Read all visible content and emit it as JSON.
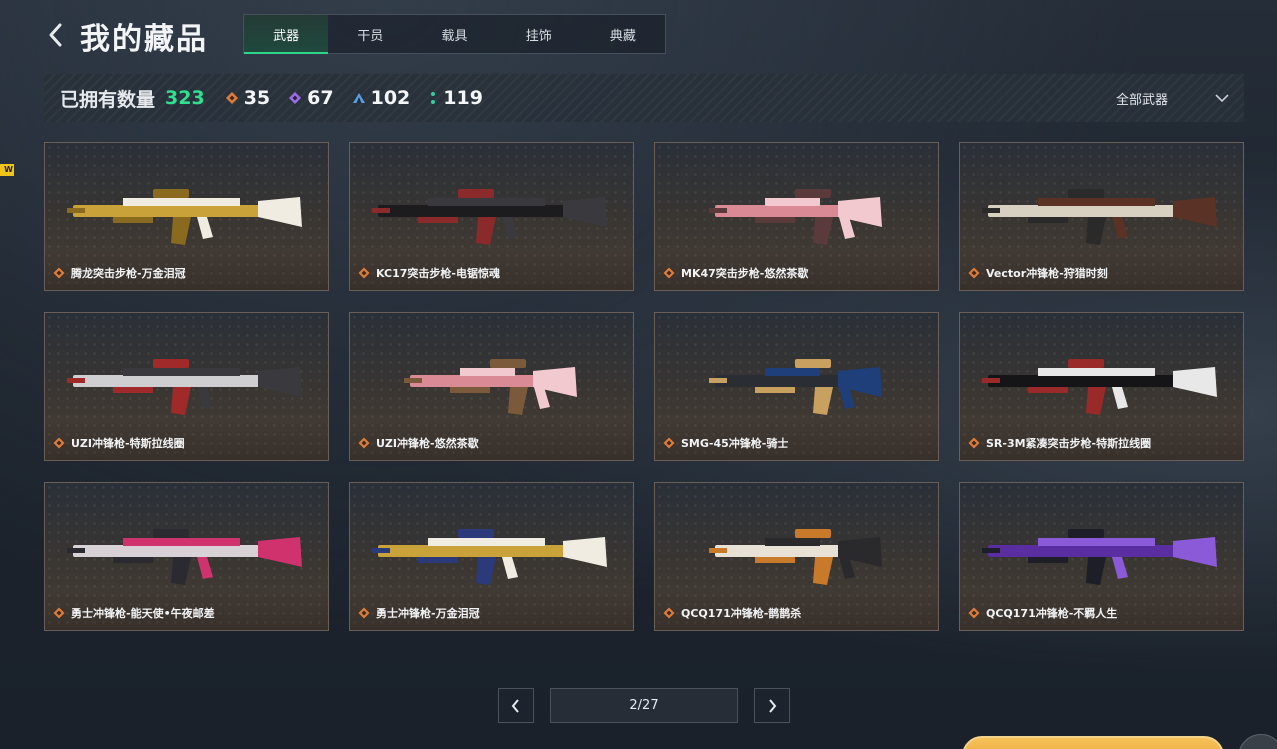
{
  "header": {
    "title": "我的藏品",
    "tabs": [
      {
        "label": "武器",
        "active": true
      },
      {
        "label": "干员",
        "active": false
      },
      {
        "label": "载具",
        "active": false
      },
      {
        "label": "挂饰",
        "active": false
      },
      {
        "label": "典藏",
        "active": false
      }
    ]
  },
  "badge": {
    "text": "W"
  },
  "stats": {
    "owned_label": "已拥有数量",
    "owned_count": "323",
    "rarities": [
      {
        "icon": "orange-diamond-icon",
        "color": "#e07c3a",
        "count": "35"
      },
      {
        "icon": "purple-diamond-icon",
        "color": "#9b6ee8",
        "count": "67"
      },
      {
        "icon": "blue-triangle-icon",
        "color": "#5aa0e0",
        "count": "102"
      },
      {
        "icon": "green-dots-icon",
        "color": "#2fd0a0",
        "count": "119"
      }
    ],
    "filter": {
      "label": "全部武器",
      "icon": "chevron-down-icon"
    }
  },
  "items": [
    {
      "name": "腾龙突击步枪-万金泪冠",
      "rarity_color": "#e07c3a",
      "skin": [
        "#c9a23a",
        "#f1ece2",
        "#8a6a1e"
      ]
    },
    {
      "name": "KC17突击步枪-电锯惊魂",
      "rarity_color": "#e07c3a",
      "skin": [
        "#1c1c1e",
        "#3a3a3e",
        "#8a2a2a"
      ]
    },
    {
      "name": "MK47突击步枪-悠然茶歇",
      "rarity_color": "#e07c3a",
      "skin": [
        "#d98a94",
        "#f2c9cf",
        "#5a3a3a"
      ]
    },
    {
      "name": "Vector冲锋枪-狩猎时刻",
      "rarity_color": "#e07c3a",
      "skin": [
        "#d8d0c0",
        "#5a3226",
        "#2a2a2a"
      ]
    },
    {
      "name": "UZI冲锋枪-特斯拉线圈",
      "rarity_color": "#e07c3a",
      "skin": [
        "#cfcfd2",
        "#3a3a3e",
        "#a02a2a"
      ]
    },
    {
      "name": "UZI冲锋枪-悠然茶歇",
      "rarity_color": "#e07c3a",
      "skin": [
        "#d98a94",
        "#f2c9cf",
        "#7a5a3a"
      ]
    },
    {
      "name": "SMG-45冲锋枪-骑士",
      "rarity_color": "#e07c3a",
      "skin": [
        "#2a2d33",
        "#1e3f7a",
        "#c8a060"
      ]
    },
    {
      "name": "SR-3M紧凑突击步枪-特斯拉线圈",
      "rarity_color": "#e07c3a",
      "skin": [
        "#151517",
        "#e8e8e8",
        "#9a2a2a"
      ]
    },
    {
      "name": "勇士冲锋枪-能天使•午夜邮差",
      "rarity_color": "#e07c3a",
      "skin": [
        "#d8d2d6",
        "#d0326e",
        "#2a2a30"
      ]
    },
    {
      "name": "勇士冲锋枪-万金泪冠",
      "rarity_color": "#e07c3a",
      "skin": [
        "#c9a23a",
        "#f1ece2",
        "#2a3a7a"
      ]
    },
    {
      "name": "QCQ171冲锋枪-鹊鹊杀",
      "rarity_color": "#e07c3a",
      "skin": [
        "#e8e2d6",
        "#2a2a2c",
        "#c87a2a"
      ]
    },
    {
      "name": "QCQ171冲锋枪-不羁人生",
      "rarity_color": "#e07c3a",
      "skin": [
        "#5a2ea0",
        "#8a5ad8",
        "#1e1e28"
      ]
    }
  ],
  "pagination": {
    "current": "2/27"
  }
}
